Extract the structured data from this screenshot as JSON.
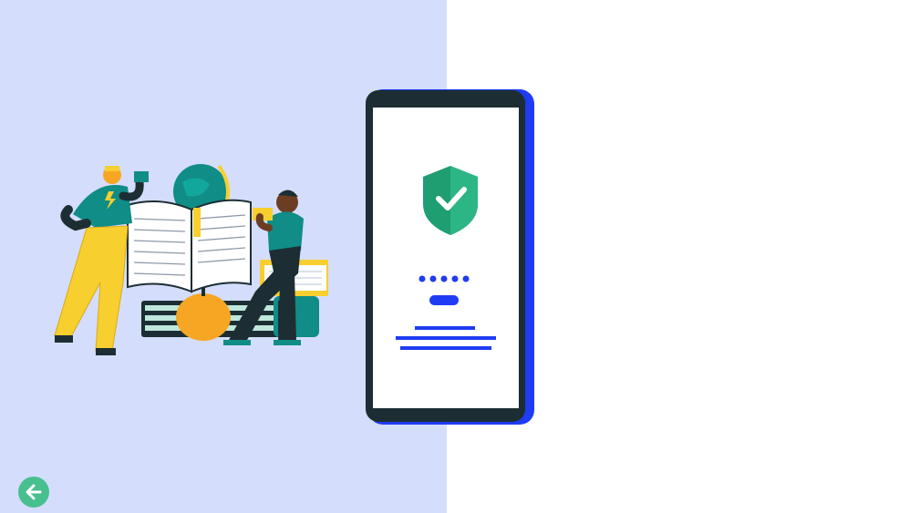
{
  "colors": {
    "left_background": "#d5ddfc",
    "right_background": "#ffffff",
    "phone_frame": "#1f3cf2",
    "phone_bezel": "#1c2e33",
    "phone_screen": "#ffffff",
    "shield": "#1f9e72",
    "shield_highlight": "#2cb585",
    "check": "#ffffff",
    "pin_dots": "#1f3cf2",
    "back_button": "#48bf8f",
    "back_arrow": "#ffffff"
  },
  "icons": {
    "back": "arrow-left-icon",
    "shield": "shield-check-icon"
  },
  "illustration": {
    "subject": "people-reading-books-illustration"
  },
  "phone_screen": {
    "pin_dot_count": 5
  }
}
